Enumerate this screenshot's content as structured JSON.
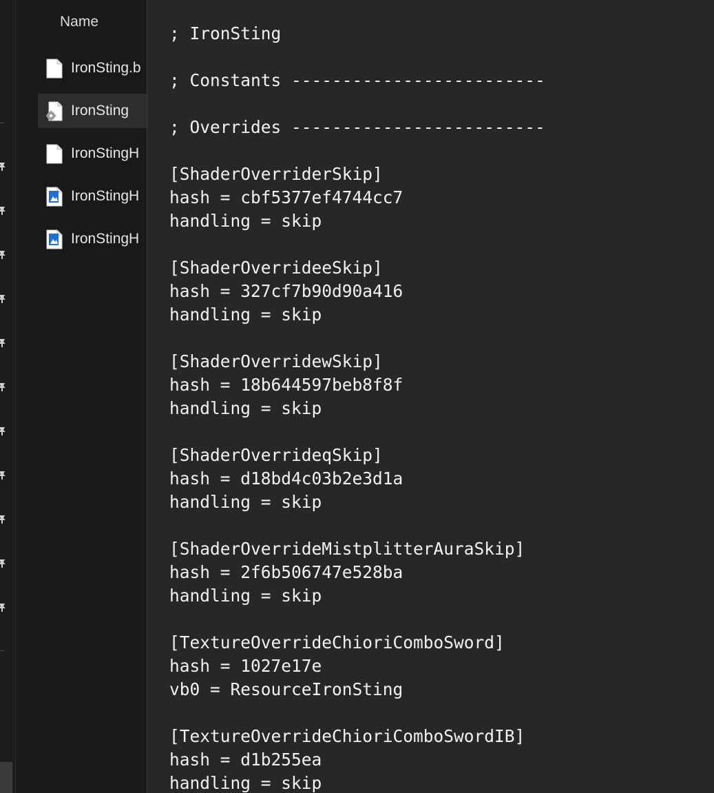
{
  "file_list": {
    "column_header": "Name",
    "files": [
      {
        "name": "IronSting.b",
        "icon": "blank-document-icon",
        "selected": false
      },
      {
        "name": "IronSting",
        "icon": "config-settings-file-icon",
        "selected": true
      },
      {
        "name": "IronStingH",
        "icon": "blank-document-icon",
        "selected": false
      },
      {
        "name": "IronStingH",
        "icon": "image-file-icon",
        "selected": false
      },
      {
        "name": "IronStingH",
        "icon": "image-file-icon",
        "selected": false
      }
    ]
  },
  "editor": {
    "content": "; IronSting\n\n; Constants -------------------------\n\n; Overrides -------------------------\n\n[ShaderOverriderSkip]\nhash = cbf5377ef4744cc7\nhandling = skip\n\n[ShaderOverrideeSkip]\nhash = 327cf7b90d90a416\nhandling = skip\n\n[ShaderOverridewSkip]\nhash = 18b644597beb8f8f\nhandling = skip\n\n[ShaderOverrideqSkip]\nhash = d18bd4c03b2e3d1a\nhandling = skip\n\n[ShaderOverrideMistplitterAuraSkip]\nhash = 2f6b506747e528ba\nhandling = skip\n\n[TextureOverrideChioriComboSword]\nhash = 1027e17e\nvb0 = ResourceIronSting\n\n[TextureOverrideChioriComboSwordIB]\nhash = d1b255ea\nhandling = skip"
  },
  "colors": {
    "background": "#191919",
    "editor_background": "#272727",
    "text": "#f2f2f2",
    "selected_row": "#2d2d2d",
    "image_icon_accent": "#1e6fd0"
  },
  "nav_pane": {
    "pin_icon": "pin-icon",
    "pinned_count": 11
  }
}
